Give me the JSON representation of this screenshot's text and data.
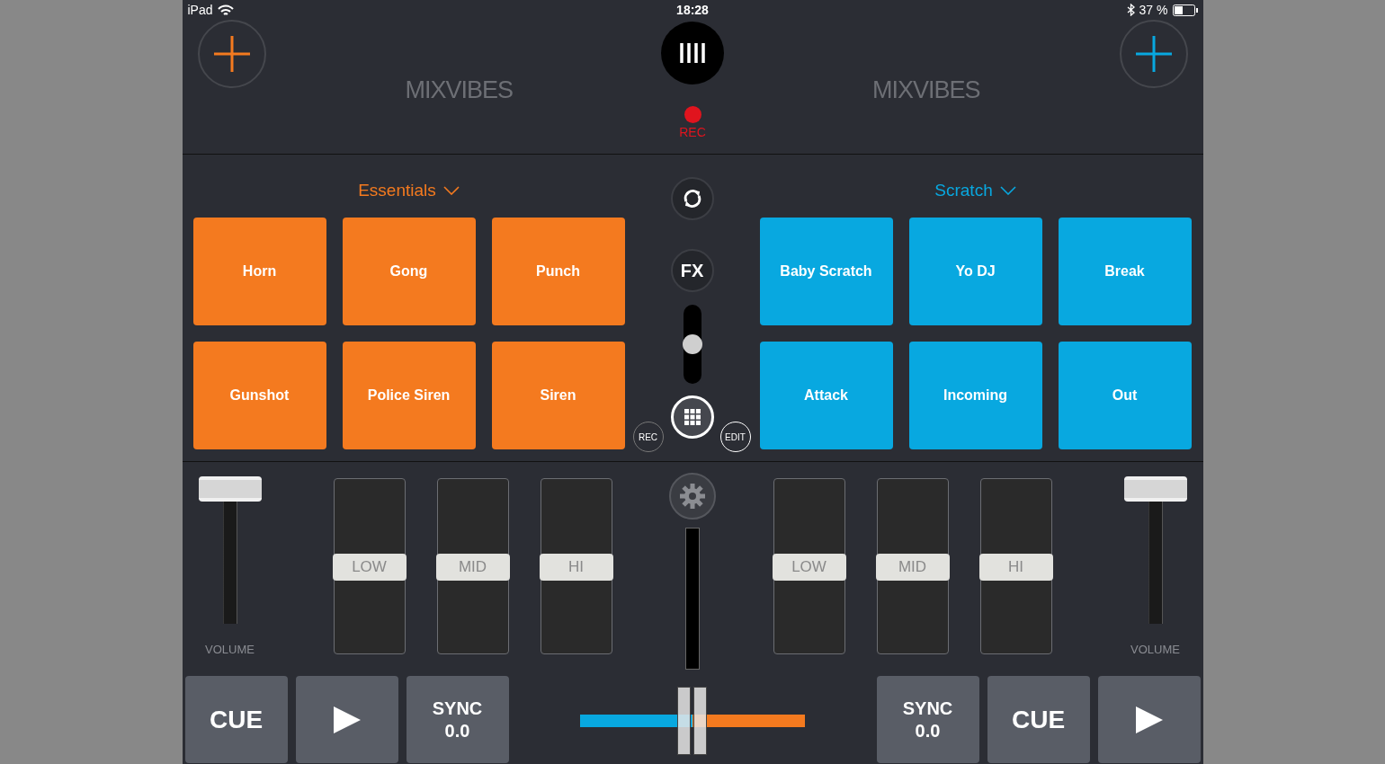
{
  "status_bar": {
    "device": "iPad",
    "time": "18:28",
    "battery": "37 %"
  },
  "recorder": {
    "label": "REC"
  },
  "decks": [
    {
      "color": "#f47a1f",
      "logo": "MIXVIBES",
      "bank": "Essentials",
      "pads": [
        "Horn",
        "Gong",
        "Punch",
        "Gunshot",
        "Police Siren",
        "Siren"
      ],
      "volume": {
        "label": "VOLUME",
        "level": 1
      },
      "eq": [
        {
          "label": "LOW",
          "level": 0.5
        },
        {
          "label": "MID",
          "level": 0.5
        },
        {
          "label": "HI",
          "level": 0.5
        }
      ],
      "transport": [
        {
          "kind": "cue",
          "label": "CUE"
        },
        {
          "kind": "play"
        },
        {
          "kind": "sync",
          "label": "SYNC",
          "value": "0.0"
        }
      ]
    },
    {
      "color": "#08a8e0",
      "logo": "MIXVIBES",
      "bank": "Scratch",
      "pads": [
        "Baby Scratch",
        "Yo DJ",
        "Break",
        "Attack",
        "Incoming",
        "Out"
      ],
      "volume": {
        "label": "VOLUME",
        "level": 1
      },
      "eq": [
        {
          "label": "LOW",
          "level": 0.5
        },
        {
          "label": "MID",
          "level": 0.5
        },
        {
          "label": "HI",
          "level": 0.5
        }
      ],
      "transport": [
        {
          "kind": "sync",
          "label": "SYNC",
          "value": "0.0"
        },
        {
          "kind": "cue",
          "label": "CUE"
        },
        {
          "kind": "play"
        }
      ]
    }
  ],
  "center": {
    "fx": {
      "label": "FX",
      "level": 0.5
    },
    "pad_rec": "REC",
    "pad_edit": "EDIT"
  },
  "crossfader": {
    "level": 0.5
  }
}
